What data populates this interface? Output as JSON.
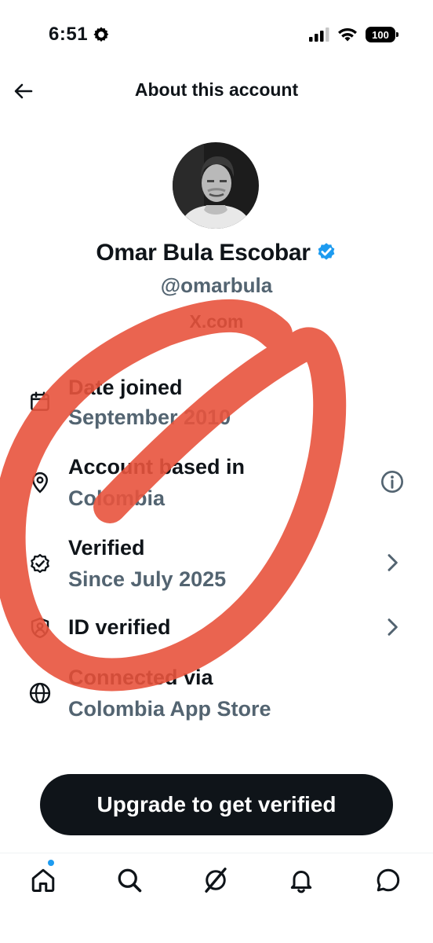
{
  "status_bar": {
    "time": "6:51",
    "battery": "100"
  },
  "header": {
    "title": "About this account"
  },
  "profile": {
    "name": "Omar Bula Escobar",
    "handle": "@omarbula",
    "site": "X.com"
  },
  "info_rows": [
    {
      "label": "Date joined",
      "value": "September 2010",
      "icon": "calendar-icon"
    },
    {
      "label": "Account based in",
      "value": "Colombia",
      "icon": "location-pin-icon",
      "action_icon": "info-icon"
    },
    {
      "label": "Verified",
      "value": "Since July 2025",
      "icon": "verified-badge-outline-icon",
      "action_icon": "chevron-right-icon"
    },
    {
      "label": "ID verified",
      "icon": "id-shield-icon",
      "action_icon": "chevron-right-icon"
    },
    {
      "label": "Connected via",
      "value": "Colombia App Store",
      "icon": "globe-icon"
    }
  ],
  "cta": {
    "label": "Upgrade to get verified"
  },
  "tab_bar": {
    "tabs": [
      "home-icon",
      "search-icon",
      "grok-icon",
      "notifications-icon",
      "messages-icon"
    ]
  },
  "colors": {
    "text_primary": "#0f1419",
    "text_secondary": "#536471",
    "verified_blue": "#1d9bf0",
    "annotation_red": "#e8533d",
    "button_bg": "#0f1419"
  }
}
